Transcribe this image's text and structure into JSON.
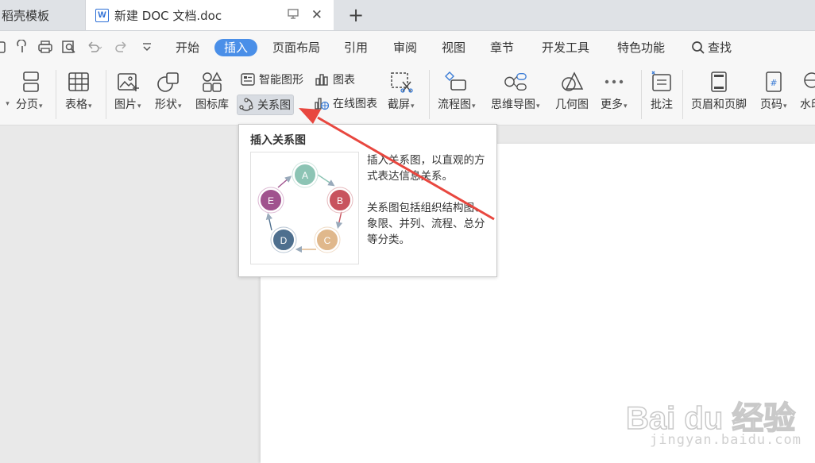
{
  "tabs": {
    "template_label": "稻壳模板",
    "doc_label": "新建 DOC 文档.doc",
    "doc_icon_letter": "W",
    "close_glyph": "✕",
    "new_tab_glyph": "+"
  },
  "menu": {
    "items": [
      "开始",
      "插入",
      "页面布局",
      "引用",
      "审阅",
      "视图",
      "章节",
      "开发工具",
      "特色功能"
    ],
    "active": "插入",
    "search_label": "查找"
  },
  "ribbon": {
    "page_break": "分页",
    "table": "表格",
    "picture": "图片",
    "shape": "形状",
    "icon_library": "图标库",
    "smart_art": "智能图形",
    "chart": "图表",
    "relation_chart": "关系图",
    "online_chart": "在线图表",
    "screenshot": "截屏",
    "flowchart": "流程图",
    "mindmap": "思维导图",
    "geometry": "几何图",
    "more": "更多",
    "comment": "批注",
    "header_footer": "页眉和页脚",
    "page_number": "页码",
    "watermark": "水印"
  },
  "tooltip": {
    "title": "插入关系图",
    "desc1": "插入关系图，以直观的方式表达信息关系。",
    "desc2": "关系图包括组织结构图、象限、并列、流程、总分等分类。",
    "diagram_nodes": [
      "A",
      "B",
      "C",
      "D",
      "E"
    ]
  },
  "colors": {
    "accent": "#4a8fe8",
    "arrow": "#e8473f",
    "node_a": "#8cc4b4",
    "node_b": "#c8535e",
    "node_c": "#e0b88c",
    "node_d": "#4e6f8e",
    "node_e": "#a0528e"
  },
  "watermark": {
    "main": "Bai du 经验",
    "url": "jingyan.baidu.com"
  }
}
